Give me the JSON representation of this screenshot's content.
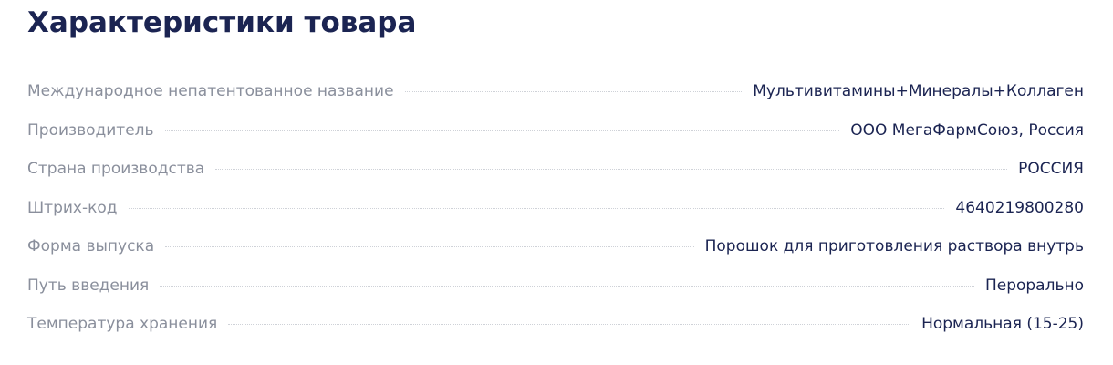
{
  "section": {
    "title": "Характеристики товара"
  },
  "specs": [
    {
      "label": "Международное непатентованное название",
      "value": "Мультивитамины+Минералы+Коллаген"
    },
    {
      "label": "Производитель",
      "value": "ООО МегаФармСоюз, Россия"
    },
    {
      "label": "Страна производства",
      "value": "РОССИЯ"
    },
    {
      "label": "Штрих-код",
      "value": "4640219800280"
    },
    {
      "label": "Форма выпуска",
      "value": "Порошок для приготовления раствора внутрь"
    },
    {
      "label": "Путь введения",
      "value": "Перорально"
    },
    {
      "label": "Температура хранения",
      "value": "Нормальная (15-25)"
    }
  ],
  "colors": {
    "title": "#1b2452",
    "label": "#8a8f9c",
    "value": "#1b2452",
    "leader": "#cfd2d8"
  }
}
